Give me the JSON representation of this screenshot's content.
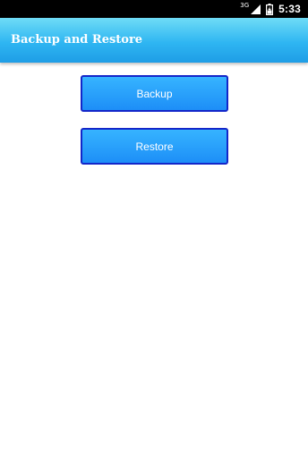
{
  "status_bar": {
    "network": "3G",
    "time": "5:33",
    "icons": [
      "signal-icon",
      "battery-icon"
    ]
  },
  "app_bar": {
    "title": "Backup and Restore",
    "colors": {
      "top": "#6fdcf6",
      "bottom": "#1e9de6"
    }
  },
  "actions": {
    "backup_label": "Backup",
    "restore_label": "Restore",
    "colors": {
      "fill_top": "#36b4ff",
      "fill_bottom": "#1d8ef7",
      "border": "#1326c9"
    }
  }
}
